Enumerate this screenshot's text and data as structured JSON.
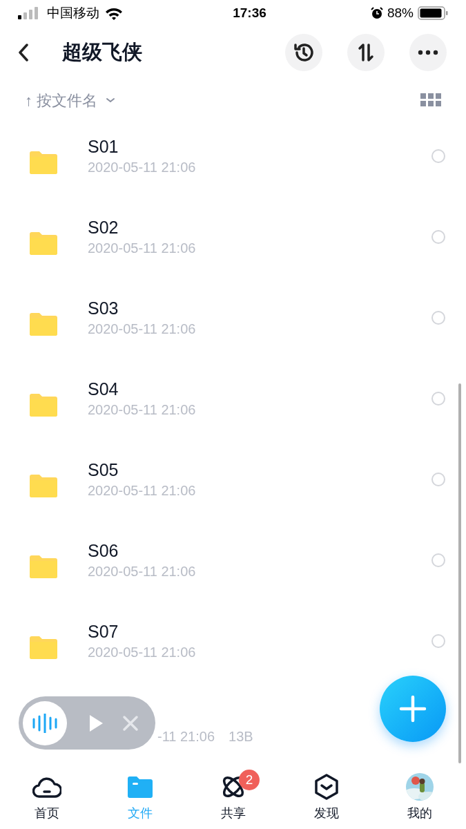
{
  "status_bar": {
    "carrier": "中国移动",
    "time": "17:36",
    "battery": "88%"
  },
  "header": {
    "title": "超级飞侠"
  },
  "sort": {
    "arrow": "↑",
    "label": "按文件名"
  },
  "files": [
    {
      "kind": "folder",
      "name": "S01",
      "date": "2020-05-11 21:06",
      "checked": false
    },
    {
      "kind": "folder",
      "name": "S02",
      "date": "2020-05-11 21:06",
      "checked": false
    },
    {
      "kind": "folder",
      "name": "S03",
      "date": "2020-05-11 21:06",
      "checked": false
    },
    {
      "kind": "folder",
      "name": "S04",
      "date": "2020-05-11 21:06",
      "checked": false
    },
    {
      "kind": "folder",
      "name": "S05",
      "date": "2020-05-11 21:06",
      "checked": false
    },
    {
      "kind": "folder",
      "name": "S06",
      "date": "2020-05-11 21:06",
      "checked": false
    },
    {
      "kind": "folder",
      "name": "S07",
      "date": "2020-05-11 21:06",
      "checked": false
    },
    {
      "kind": "partial",
      "date": "-11 21:06",
      "size": "13B"
    }
  ],
  "nav": [
    {
      "kind": "home",
      "label": "首页",
      "selected": false
    },
    {
      "kind": "files",
      "label": "文件",
      "selected": true
    },
    {
      "kind": "share",
      "label": "共享",
      "selected": false,
      "badge": "2"
    },
    {
      "kind": "discover",
      "label": "发现",
      "selected": false
    },
    {
      "kind": "me",
      "label": "我的",
      "selected": false
    }
  ]
}
